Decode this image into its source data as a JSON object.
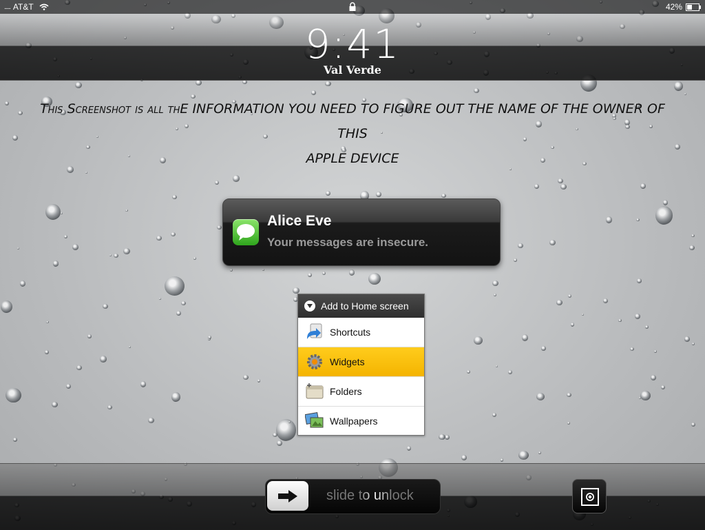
{
  "status_bar": {
    "carrier": "AT&T",
    "battery": "42%",
    "battery_level": 0.42
  },
  "lock_screen": {
    "time": "9:41",
    "location": "Val Verde"
  },
  "headline": {
    "line1": "This Screenshot is all thE INFORMATION YOU NEED TO FIGURE OUT THE NAME OF THE OWNER OF THIS",
    "line2": "APPLE DEVICE"
  },
  "notification": {
    "sender": "Alice Eve",
    "message": "Your messages are insecure."
  },
  "menu": {
    "title": "Add to Home screen",
    "items": [
      {
        "label": "Shortcuts",
        "selected": false
      },
      {
        "label": "Widgets",
        "selected": true
      },
      {
        "label": "Folders",
        "selected": false
      },
      {
        "label": "Wallpapers",
        "selected": false
      }
    ]
  },
  "unlock": {
    "label": "slide to unlock"
  },
  "icons": {
    "messages": "speech-bubble-icon",
    "slider_knob": "right-arrow-icon",
    "picture_frame": "picture-frame-icon"
  }
}
